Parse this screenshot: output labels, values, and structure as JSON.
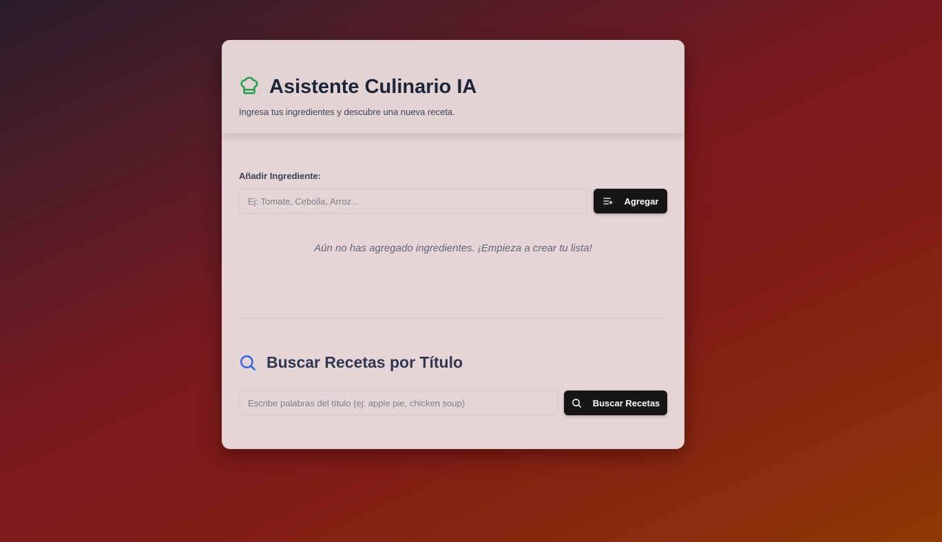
{
  "header": {
    "title": "Asistente Culinario IA",
    "subtitle": "Ingresa tus ingredientes y descubre una nueva receta.",
    "icon": "chef-hat-icon",
    "icon_color": "#16a34a"
  },
  "ingredients": {
    "label": "Añadir Ingrediente:",
    "input_placeholder": "Ej: Tomate, Cebolla, Arroz...",
    "input_value": "",
    "add_button_label": "Agregar",
    "empty_message": "Aún no has agregado ingredientes. ¡Empieza a crear tu lista!"
  },
  "search": {
    "title": "Buscar Recetas por Título",
    "icon": "search-icon",
    "icon_color": "#2563eb",
    "input_placeholder": "Escribe palabras del título (ej: apple pie, chicken soup)",
    "input_value": "",
    "button_label": "Buscar Recetas"
  },
  "colors": {
    "button_bg": "#161616",
    "title_text": "#1c2438"
  }
}
